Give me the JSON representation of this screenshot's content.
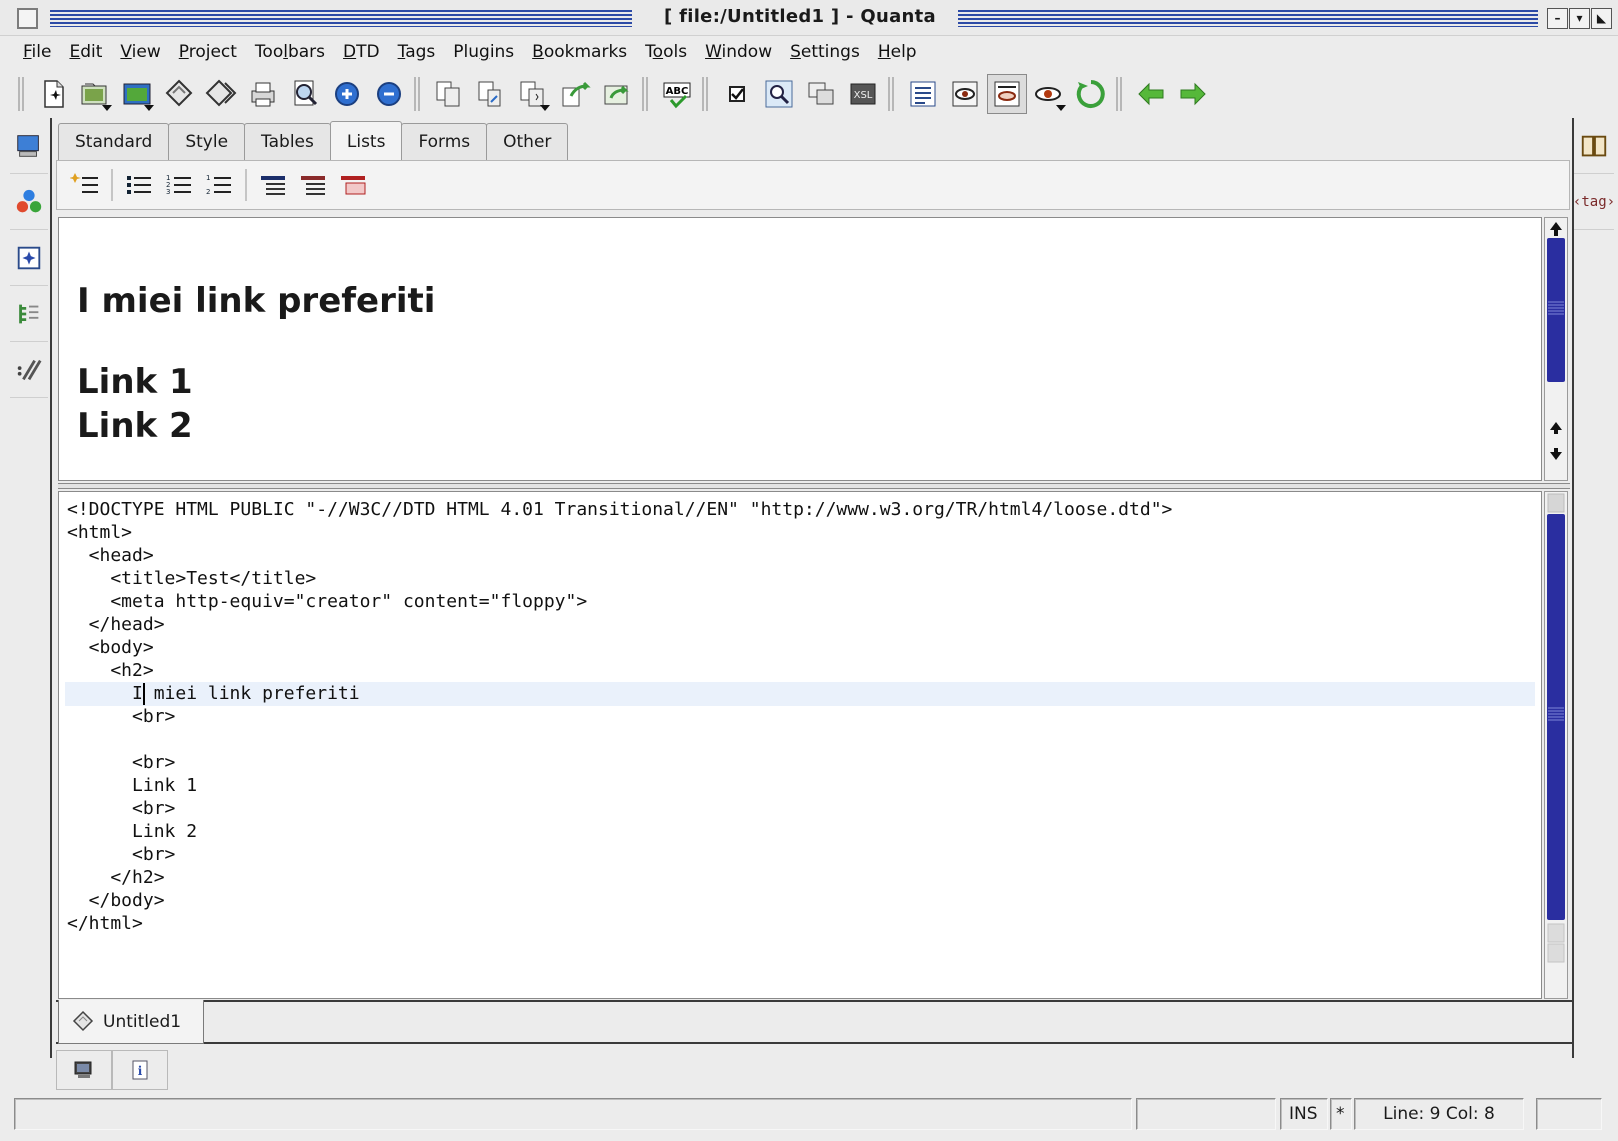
{
  "window": {
    "title": "[ file:/Untitled1 ]  - Quanta"
  },
  "menu": [
    {
      "pre": "",
      "ul": "F",
      "post": "ile"
    },
    {
      "pre": "",
      "ul": "E",
      "post": "dit"
    },
    {
      "pre": "",
      "ul": "V",
      "post": "iew"
    },
    {
      "pre": "",
      "ul": "P",
      "post": "roject"
    },
    {
      "pre": "Too",
      "ul": "l",
      "post": "bars"
    },
    {
      "pre": "",
      "ul": "D",
      "post": "TD"
    },
    {
      "pre": "",
      "ul": "T",
      "post": "ags"
    },
    {
      "pre": "Plu",
      "ul": "g",
      "post": "ins"
    },
    {
      "pre": "",
      "ul": "B",
      "post": "ookmarks"
    },
    {
      "pre": "T",
      "ul": "o",
      "post": "ols"
    },
    {
      "pre": "",
      "ul": "W",
      "post": "indow"
    },
    {
      "pre": "",
      "ul": "S",
      "post": "ettings"
    },
    {
      "pre": "",
      "ul": "H",
      "post": "elp"
    }
  ],
  "quick_toolbar": {
    "tabs": [
      "Standard",
      "Style",
      "Tables",
      "Lists",
      "Forms",
      "Other"
    ],
    "active_tab": "Lists"
  },
  "preview": {
    "heading": "I miei link preferiti",
    "links": [
      "Link 1",
      "Link 2"
    ]
  },
  "editor": {
    "lines": [
      "<!DOCTYPE HTML PUBLIC \"-//W3C//DTD HTML 4.01 Transitional//EN\" \"http://www.w3.org/TR/html4/loose.dtd\">",
      "<html>",
      "  <head>",
      "    <title>Test</title>",
      "    <meta http-equiv=\"creator\" content=\"floppy\">",
      "  </head>",
      "  <body>",
      "    <h2>",
      "      I miei link preferiti",
      "      <br>",
      "",
      "      <br>",
      "      Link 1",
      "      <br>",
      "      Link 2",
      "      <br>",
      "    </h2>",
      "  </body>",
      "</html>"
    ],
    "current_line": 9,
    "current_col": 8
  },
  "document_tabs": [
    "Untitled1"
  ],
  "status": {
    "mode": "INS",
    "modified": "*",
    "position": "Line: 9 Col: 8"
  },
  "colors": {
    "title_stripe": "#2c4aa6",
    "scrollbar": "#2a2ea0",
    "current_line": "#eaf1fb"
  },
  "icons": {
    "toolbar": [
      "new-file-icon",
      "open-file-icon",
      "open-recent-icon",
      "save-icon",
      "save-all-icon",
      "print-icon",
      "print-preview-icon",
      "zoom-in-icon",
      "zoom-out-icon",
      "copy-icon",
      "cut-icon",
      "paste-icon",
      "upload-icon",
      "publish-icon",
      "spellcheck-icon",
      "checkbox-icon",
      "find-icon",
      "template-icon",
      "xsl-icon",
      "structure-icon",
      "preview-icon",
      "preview-split-icon",
      "preview-eye-icon",
      "reload-icon",
      "back-arrow-icon",
      "forward-arrow-icon"
    ]
  }
}
